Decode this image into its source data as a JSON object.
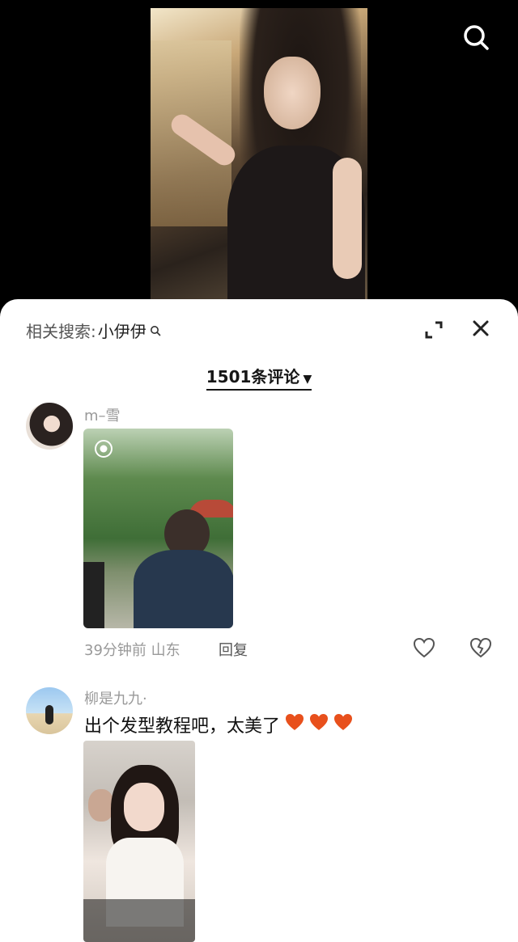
{
  "related_search": {
    "label": "相关搜索:",
    "keyword": "小伊伊"
  },
  "comment_count": "1501条评论",
  "comments": [
    {
      "user": "m–雪",
      "meta": "39分钟前 山东",
      "reply_label": "回复"
    },
    {
      "user": "柳是九九·",
      "text": "出个发型教程吧，太美了"
    }
  ],
  "colors": {
    "background": "#000000",
    "sheet": "#ffffff",
    "heart": "#e8501c"
  },
  "icons": [
    "search-icon",
    "expand-icon",
    "close-icon",
    "camera-icon",
    "heart-icon",
    "broken-heart-icon"
  ]
}
